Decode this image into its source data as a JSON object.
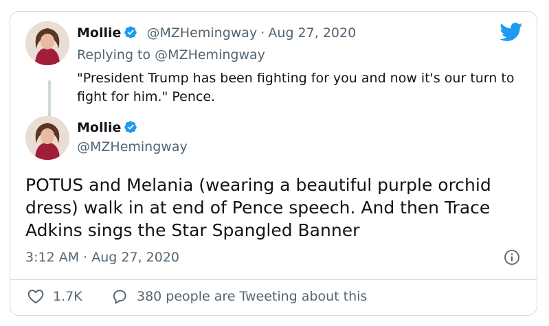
{
  "quoted_tweet": {
    "display_name": "Mollie",
    "handle": "@MZHemingway",
    "separator": "·",
    "date": "Aug 27, 2020",
    "reply_prefix": "Replying to",
    "reply_handle": "@MZHemingway",
    "text": "\"President Trump has been fighting for you and now it's our turn to fight for him.\" Pence."
  },
  "main_tweet": {
    "display_name": "Mollie",
    "handle": "@MZHemingway",
    "text": "POTUS and Melania (wearing a beautiful purple orchid dress) walk in at end of Pence speech. And then Trace Adkins sings the Star Spangled Banner",
    "time": "3:12 AM",
    "separator": "·",
    "date": "Aug 27, 2020"
  },
  "footer": {
    "like_count": "1.7K",
    "discussion_text": "380 people are Tweeting about this"
  },
  "icons": {
    "brand": "twitter-bird-icon",
    "verified": "verified-badge-icon",
    "info": "info-icon",
    "like": "heart-icon",
    "reply": "speech-bubble-icon"
  },
  "colors": {
    "brand_blue": "#1d9bf0",
    "text_primary": "#0f1419",
    "text_secondary": "#536471",
    "border": "#cfd9de"
  }
}
